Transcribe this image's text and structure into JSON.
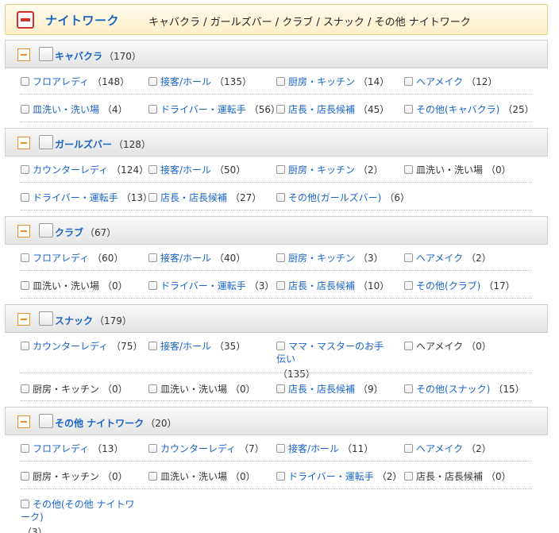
{
  "top": {
    "title": "ナイトワーク",
    "subtitle": "キャバクラ / ガールズバー / クラブ / スナック / その他 ナイトワーク"
  },
  "sections": [
    {
      "name": "キャバクラ",
      "count": "（170）",
      "items": [
        {
          "name": "フロアレディ",
          "count": "（148）",
          "link": true
        },
        {
          "name": "接客/ホール",
          "count": "（135）",
          "link": true
        },
        {
          "name": "厨房・キッチン",
          "count": "（14）",
          "link": true
        },
        {
          "name": "ヘアメイク",
          "count": "（12）",
          "link": true
        },
        {
          "name": "皿洗い・洗い場",
          "count": "（4）",
          "link": true
        },
        {
          "name": "ドライバー・運転手",
          "count": "（56）",
          "link": true
        },
        {
          "name": "店長・店長候補",
          "count": "（45）",
          "link": true
        },
        {
          "name": "その他(キャバクラ)",
          "count": "（25）",
          "link": true
        }
      ]
    },
    {
      "name": "ガールズバー",
      "count": "（128）",
      "items": [
        {
          "name": "カウンターレディ",
          "count": "（124）",
          "link": true
        },
        {
          "name": "接客/ホール",
          "count": "（50）",
          "link": true
        },
        {
          "name": "厨房・キッチン",
          "count": "（2）",
          "link": true
        },
        {
          "name": "皿洗い・洗い場",
          "count": "（0）",
          "link": false
        },
        {
          "name": "ドライバー・運転手",
          "count": "（13）",
          "link": true
        },
        {
          "name": "店長・店長候補",
          "count": "（27）",
          "link": true
        },
        {
          "name": "その他(ガールズバー)",
          "count": "（6）",
          "link": true
        }
      ]
    },
    {
      "name": "クラブ",
      "count": "（67）",
      "items": [
        {
          "name": "フロアレディ",
          "count": "（60）",
          "link": true
        },
        {
          "name": "接客/ホール",
          "count": "（40）",
          "link": true
        },
        {
          "name": "厨房・キッチン",
          "count": "（3）",
          "link": true
        },
        {
          "name": "ヘアメイク",
          "count": "（2）",
          "link": true
        },
        {
          "name": "皿洗い・洗い場",
          "count": "（0）",
          "link": false
        },
        {
          "name": "ドライバー・運転手",
          "count": "（3）",
          "link": true
        },
        {
          "name": "店長・店長候補",
          "count": "（10）",
          "link": true
        },
        {
          "name": "その他(クラブ)",
          "count": "（17）",
          "link": true
        }
      ]
    },
    {
      "name": "スナック",
      "count": "（179）",
      "items": [
        {
          "name": "カウンターレディ",
          "count": "（75）",
          "link": true
        },
        {
          "name": "接客/ホール",
          "count": "（35）",
          "link": true
        },
        {
          "name": "ママ・マスターのお手伝い",
          "count": "（135）",
          "link": true
        },
        {
          "name": "ヘアメイク",
          "count": "（0）",
          "link": false
        },
        {
          "name": "厨房・キッチン",
          "count": "（0）",
          "link": false
        },
        {
          "name": "皿洗い・洗い場",
          "count": "（0）",
          "link": false
        },
        {
          "name": "店長・店長候補",
          "count": "（9）",
          "link": true
        },
        {
          "name": "その他(スナック)",
          "count": "（15）",
          "link": true
        }
      ]
    },
    {
      "name": "その他 ナイトワーク",
      "count": "（20）",
      "items": [
        {
          "name": "フロアレディ",
          "count": "（13）",
          "link": true
        },
        {
          "name": "カウンターレディ",
          "count": "（7）",
          "link": true
        },
        {
          "name": "接客/ホール",
          "count": "（11）",
          "link": true
        },
        {
          "name": "ヘアメイク",
          "count": "（2）",
          "link": true
        },
        {
          "name": "厨房・キッチン",
          "count": "（0）",
          "link": false
        },
        {
          "name": "皿洗い・洗い場",
          "count": "（0）",
          "link": false
        },
        {
          "name": "ドライバー・運転手",
          "count": "（2）",
          "link": true
        },
        {
          "name": "店長・店長候補",
          "count": "（0）",
          "link": false
        },
        {
          "name": "その他(その他 ナイトワーク)",
          "count": "（3）",
          "link": true
        }
      ]
    }
  ]
}
